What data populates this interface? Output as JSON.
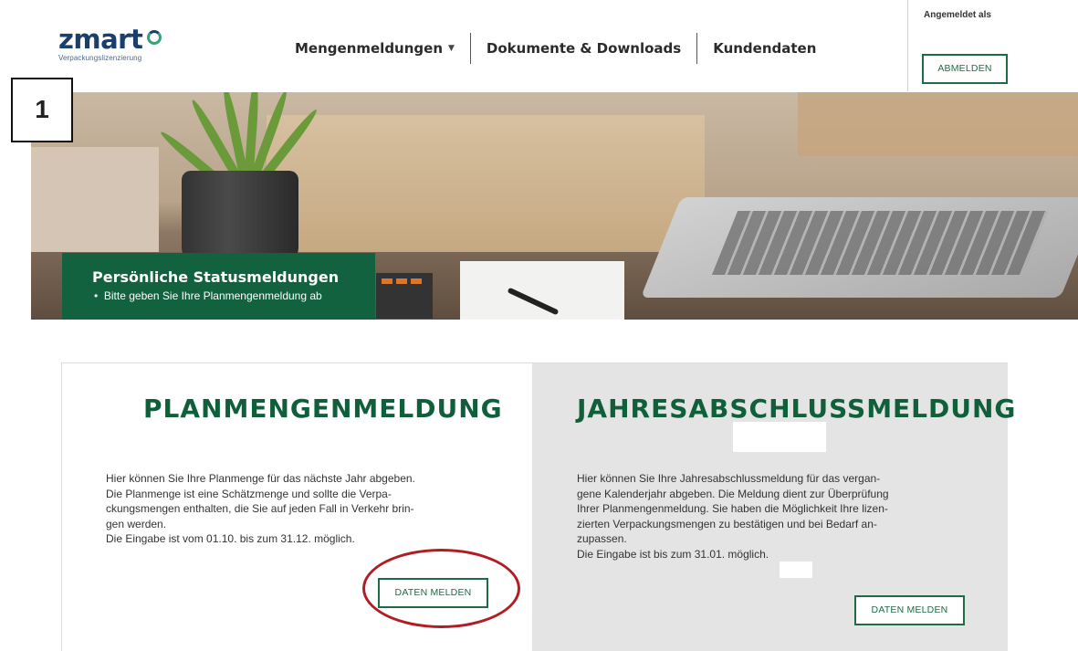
{
  "header": {
    "logo": {
      "word": "zmart",
      "tagline": "Verpackungslizenzierung"
    },
    "nav": [
      {
        "label": "Mengenmeldungen",
        "has_dropdown": true
      },
      {
        "label": "Dokumente & Downloads",
        "has_dropdown": false
      },
      {
        "label": "Kundendaten",
        "has_dropdown": false
      }
    ],
    "logged_in_label": "Angemeldet als",
    "logout_label": "ABMELDEN"
  },
  "annotation": {
    "step_number": "1"
  },
  "hero": {
    "status_title": "Persönliche Statusmeldungen",
    "status_items": [
      "Bitte geben Sie Ihre Planmengenmeldung ab"
    ]
  },
  "cards": [
    {
      "title": "PLANMENGENMELDUNG",
      "lines": [
        "Hier können Sie Ihre Planmenge für das nächste Jahr abgeben.",
        "Die Planmenge ist eine Schätzmenge und sollte die Verpa-",
        "ckungsmengen enthalten, die Sie auf jeden Fall in Verkehr brin-",
        "gen werden.",
        "Die Eingabe ist vom 01.10. bis zum 31.12. möglich."
      ],
      "button_label": "DATEN MELDEN"
    },
    {
      "title": "JAHRESABSCHLUSSMELDUNG",
      "lines": [
        "Hier können Sie Ihre Jahresabschlussmeldung für das vergan-",
        "gene Kalenderjahr abgeben. Die Meldung dient zur Überprüfung",
        "Ihrer Planmengenmeldung. Sie haben die Möglichkeit Ihre lizen-",
        "zierten Verpackungsmengen zu bestätigen und bei Bedarf an-",
        "zupassen.",
        "Die Eingabe ist bis zum 31.01.        möglich."
      ],
      "button_label": "DATEN MELDEN"
    }
  ],
  "colors": {
    "brand_green": "#12613f",
    "title_green": "#0f5f3b",
    "logo_blue": "#1b3f6b",
    "highlight_red": "#b01e24"
  }
}
